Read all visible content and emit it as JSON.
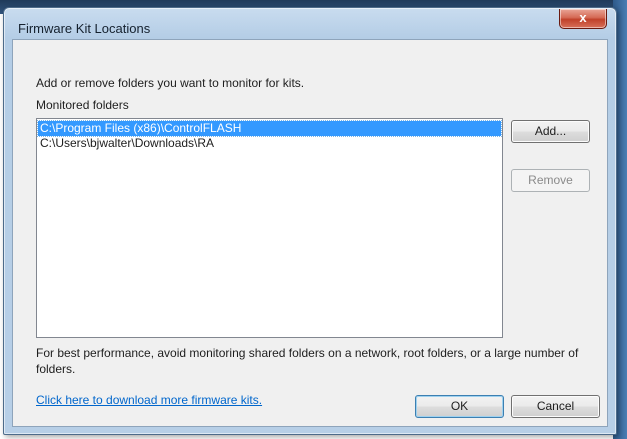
{
  "window": {
    "title": "Firmware Kit Locations",
    "close_label": "x"
  },
  "intro_text": "Add or remove folders you want to monitor for kits.",
  "list": {
    "label": "Monitored folders",
    "items": [
      {
        "path": "C:\\Program Files (x86)\\ControlFLASH",
        "selected": true
      },
      {
        "path": "C:\\Users\\bjwalter\\Downloads\\RA",
        "selected": false
      }
    ]
  },
  "buttons": {
    "add": "Add...",
    "remove": "Remove",
    "ok": "OK",
    "cancel": "Cancel"
  },
  "performance_note": "For best performance, avoid monitoring shared folders on a network, root folders, or a large number of folders.",
  "download_link": "Click here to download more firmware kits.",
  "colors": {
    "selection": "#3399ff",
    "link": "#0066cc",
    "close_button": "#c0412a"
  }
}
